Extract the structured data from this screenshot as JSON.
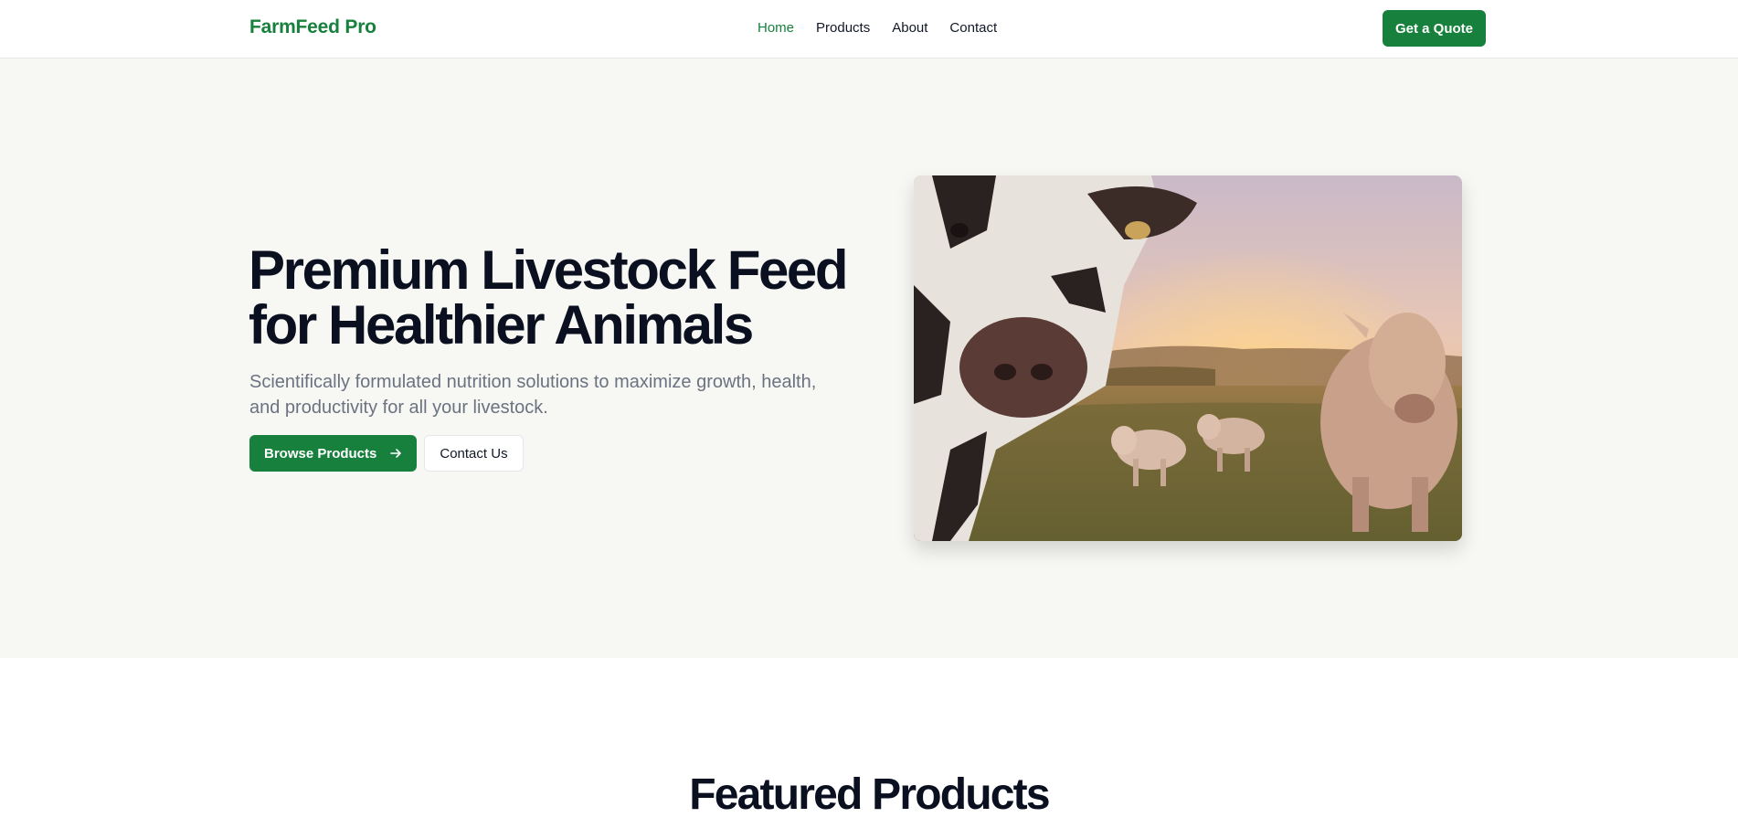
{
  "header": {
    "brand": "FarmFeed Pro",
    "nav": [
      "Home",
      "Products",
      "About",
      "Contact"
    ],
    "active_nav": "Home",
    "cta": "Get a Quote"
  },
  "hero": {
    "title_line1": "Premium Livestock Feed",
    "title_line2": "for Healthier Animals",
    "subtitle": "Scientifically formulated nutrition solutions to maximize growth, health, and productivity for all your livestock.",
    "primary_button": "Browse Products",
    "secondary_button": "Contact Us",
    "image": "cows-in-pasture-at-sunset-photo"
  },
  "featured": {
    "title": "Featured Products"
  },
  "colors": {
    "brand_green": "#17803d",
    "hero_background": "#f7f7f4"
  },
  "icons": {
    "browse_button_icon": "arrow-right-icon"
  }
}
